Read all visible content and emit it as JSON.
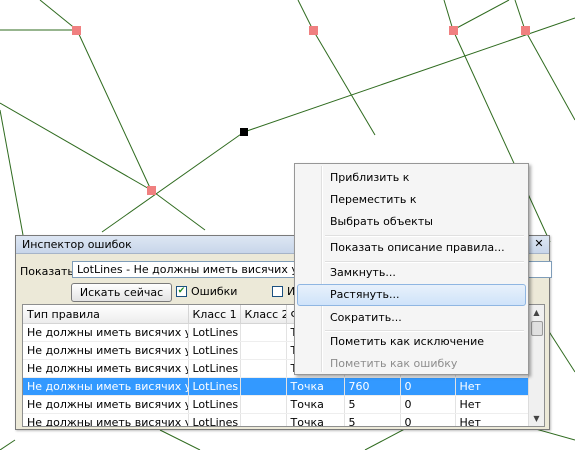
{
  "inspector": {
    "title": "Инспектор ошибок",
    "show_label": "Показать:",
    "show_value": "LotLines - Не должны иметь висячих узлов",
    "search_button": "Искать сейчас",
    "errors_checkbox_label": "Ошибки",
    "errors_checked": true,
    "second_checkbox_label": "Ис",
    "columns": [
      "Тип правила",
      "Класс 1",
      "Класс 2",
      "Ф",
      "",
      "",
      ""
    ],
    "rows": [
      [
        "Не должны иметь висячих узлов",
        "LotLines",
        "",
        "Т",
        "",
        "",
        ""
      ],
      [
        "Не должны иметь висячих узлов",
        "LotLines",
        "",
        "Т",
        "",
        "",
        ""
      ],
      [
        "Не должны иметь висячих узлов",
        "LotLines",
        "",
        "Т",
        "",
        "",
        ""
      ],
      [
        "Не должны иметь висячих узлов",
        "LotLines",
        "",
        "Точка",
        "760",
        "0",
        "Нет"
      ],
      [
        "Не должны иметь висячих узлов",
        "LotLines",
        "",
        "Точка",
        "5",
        "0",
        "Нет"
      ],
      [
        "Не должны иметь висячих узлов",
        "LotLines",
        "",
        "Точка",
        "5",
        "0",
        "Нет"
      ]
    ],
    "selected_row": 3
  },
  "context_menu": {
    "items": [
      {
        "label": "Приблизить к",
        "disabled": false
      },
      {
        "label": "Переместить  к",
        "disabled": false
      },
      {
        "label": "Выбрать объекты",
        "disabled": false
      },
      {
        "label": "Показать описание правила...",
        "disabled": false
      },
      {
        "label": "Замкнуть...",
        "disabled": false
      },
      {
        "label": "Растянуть...",
        "disabled": false,
        "highlighted": true
      },
      {
        "label": "Сократить...",
        "disabled": false
      },
      {
        "label": "Пометить как исключение",
        "disabled": false
      },
      {
        "label": "Пометить как ошибку",
        "disabled": true
      }
    ]
  },
  "colors": {
    "line": "#2f6b1f",
    "vertex": "#f08080",
    "selected_vertex": "#000000",
    "row_selection": "#3399ff",
    "menu_highlight": "#cfe3fa"
  }
}
